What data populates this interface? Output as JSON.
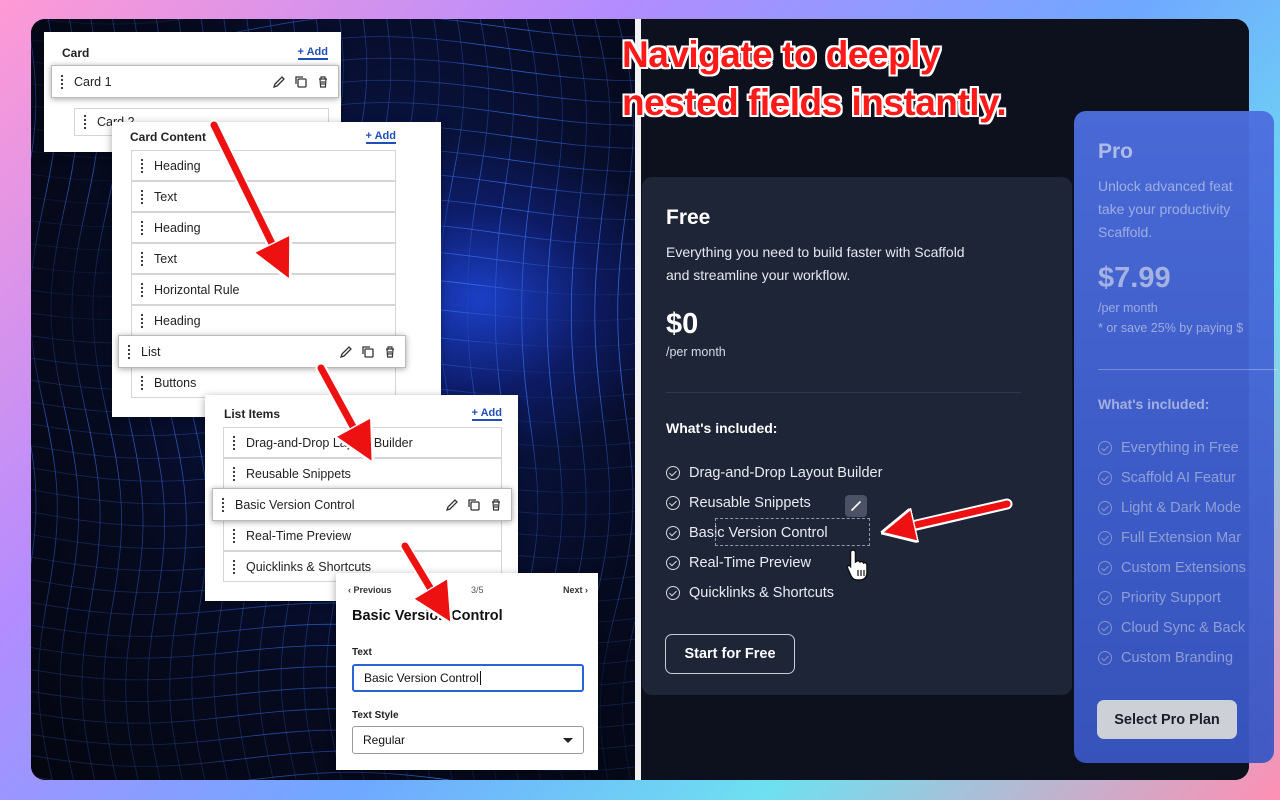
{
  "headline": {
    "line1": "Navigate to deeply",
    "line2": "nested fields instantly."
  },
  "editor": {
    "card_panel": {
      "title": "Card",
      "add_label": "+ Add",
      "items": [
        "Card 1",
        "Card 2"
      ]
    },
    "content_panel": {
      "title": "Card Content",
      "add_label": "+ Add",
      "items": [
        "Heading",
        "Text",
        "Heading",
        "Text",
        "Horizontal Rule",
        "Heading",
        "List",
        "Buttons"
      ]
    },
    "list_panel": {
      "title": "List Items",
      "add_label": "+ Add",
      "items": [
        "Drag-and-Drop Layout Builder",
        "Reusable Snippets",
        "Basic Version Control",
        "Real-Time Preview",
        "Quicklinks & Shortcuts"
      ]
    },
    "detail_panel": {
      "prev_label": "Previous",
      "next_label": "Next",
      "counter": "3/5",
      "title": "Basic Version Control",
      "text_label": "Text",
      "text_value": "Basic Version Control",
      "style_label": "Text Style",
      "style_value": "Regular"
    }
  },
  "pricing": {
    "free": {
      "name": "Free",
      "description_line1": "Everything you need to build faster with Scaffold",
      "description_line2": "and streamline your workflow.",
      "price": "$0",
      "period": "/per month",
      "included_label": "What's included:",
      "features": [
        "Drag-and-Drop Layout Builder",
        "Reusable Snippets",
        "Basic Version Control",
        "Real-Time Preview",
        "Quicklinks & Shortcuts"
      ],
      "cta": "Start for Free"
    },
    "pro": {
      "name": "Pro",
      "description_line1": "Unlock advanced feat",
      "description_line2": "take your productivity",
      "description_line3": "Scaffold.",
      "price": "$7.99",
      "period": "/per month",
      "save_note": "* or save 25% by paying $",
      "included_label": "What's included:",
      "features": [
        "Everything in Free",
        "Scaffold AI Featur",
        "Light & Dark Mode",
        "Full Extension Mar",
        "Custom Extensions",
        "Priority Support",
        "Cloud Sync & Back",
        "Custom Branding"
      ],
      "cta": "Select Pro Plan"
    }
  },
  "colors": {
    "accent_red": "#ff1a1a",
    "link_blue": "#1f4fb8",
    "pro_card": "#4d6fe0",
    "free_card": "#1d2537"
  },
  "icons": [
    "pencil-icon",
    "copy-icon",
    "trash-icon",
    "grip-icon",
    "check-circle-icon",
    "brush-icon",
    "hand-cursor-icon",
    "chevron-down-icon",
    "chevron-left-icon",
    "chevron-right-icon"
  ]
}
